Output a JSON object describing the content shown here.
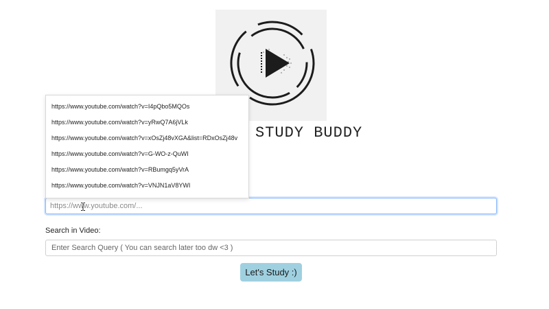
{
  "app": {
    "title": "STUDY BUDDY",
    "logo_icon": "play-button-icon",
    "accent_color": "#9fd0e0"
  },
  "url_field": {
    "value": "",
    "placeholder": "https://www.youtube.com/..."
  },
  "url_suggestions": [
    {
      "label": "https://www.youtube.com/watch?v=I4pQbo5MQOs"
    },
    {
      "label": "https://www.youtube.com/watch?v=yRwQ7A6jVLk"
    },
    {
      "label": "https://www.youtube.com/watch?v=xOsZj48vXGA&list=RDxOsZj48v"
    },
    {
      "label": "https://www.youtube.com/watch?v=G-WO-z-QuWI"
    },
    {
      "label": "https://www.youtube.com/watch?v=RBumgq5yVrA"
    },
    {
      "label": "https://www.youtube.com/watch?v=VNJN1aV8YWI"
    }
  ],
  "search": {
    "label": "Search in Video:",
    "placeholder": "Enter Search Query ( You can search later too dw <3 )",
    "value": ""
  },
  "submit": {
    "label": "Let's Study :)"
  }
}
